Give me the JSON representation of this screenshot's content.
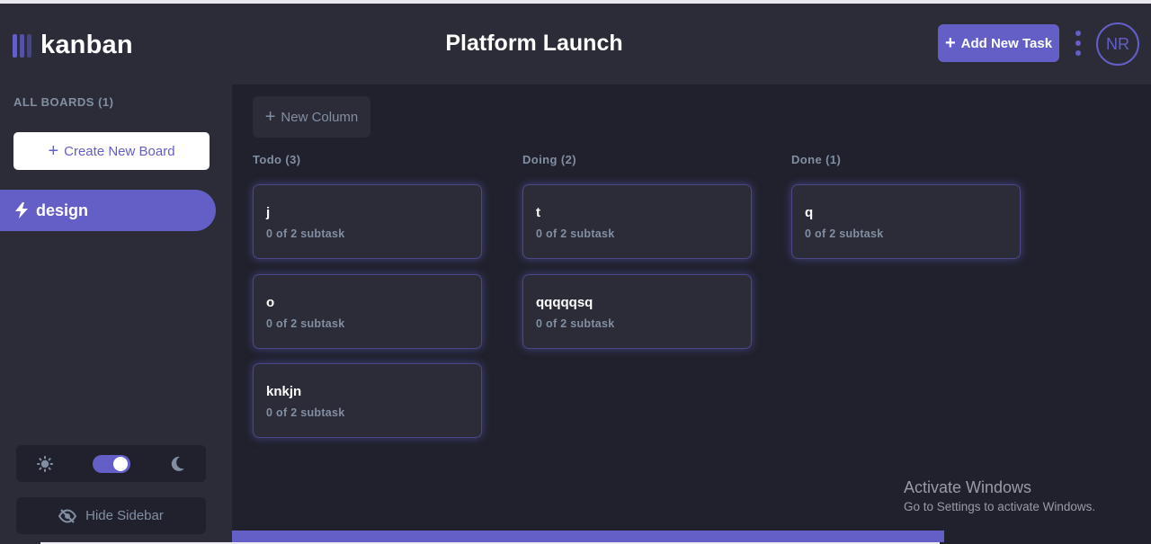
{
  "app": {
    "logo_text": "kanban",
    "board_title": "Platform Launch",
    "add_task_label": "Add New Task",
    "avatar_initials": "NR",
    "accent_color": "#635fc7"
  },
  "sidebar": {
    "all_boards_label": "ALL BOARDS (1)",
    "create_board_label": "Create New Board",
    "boards": [
      {
        "label": "design",
        "active": true,
        "icon": "lightning-icon"
      }
    ],
    "theme": {
      "light_icon": "sun-icon",
      "dark_icon": "moon-icon",
      "dark_mode": true
    },
    "hide_sidebar_label": "Hide Sidebar"
  },
  "board": {
    "new_column_label": "New Column",
    "columns": [
      {
        "title": "Todo (3)",
        "tasks": [
          {
            "title": "j",
            "subtasks": "0 of 2 subtask"
          },
          {
            "title": "o",
            "subtasks": "0 of 2 subtask"
          },
          {
            "title": "knkjn",
            "subtasks": "0 of 2 subtask"
          }
        ]
      },
      {
        "title": "Doing (2)",
        "tasks": [
          {
            "title": "t",
            "subtasks": "0 of 2 subtask"
          },
          {
            "title": "qqqqqsq",
            "subtasks": "0 of 2 subtask"
          }
        ]
      },
      {
        "title": "Done (1)",
        "tasks": [
          {
            "title": "q",
            "subtasks": "0 of 2 subtask"
          }
        ]
      }
    ]
  },
  "watermark": {
    "line1": "Activate Windows",
    "line2": "Go to Settings to activate Windows."
  }
}
